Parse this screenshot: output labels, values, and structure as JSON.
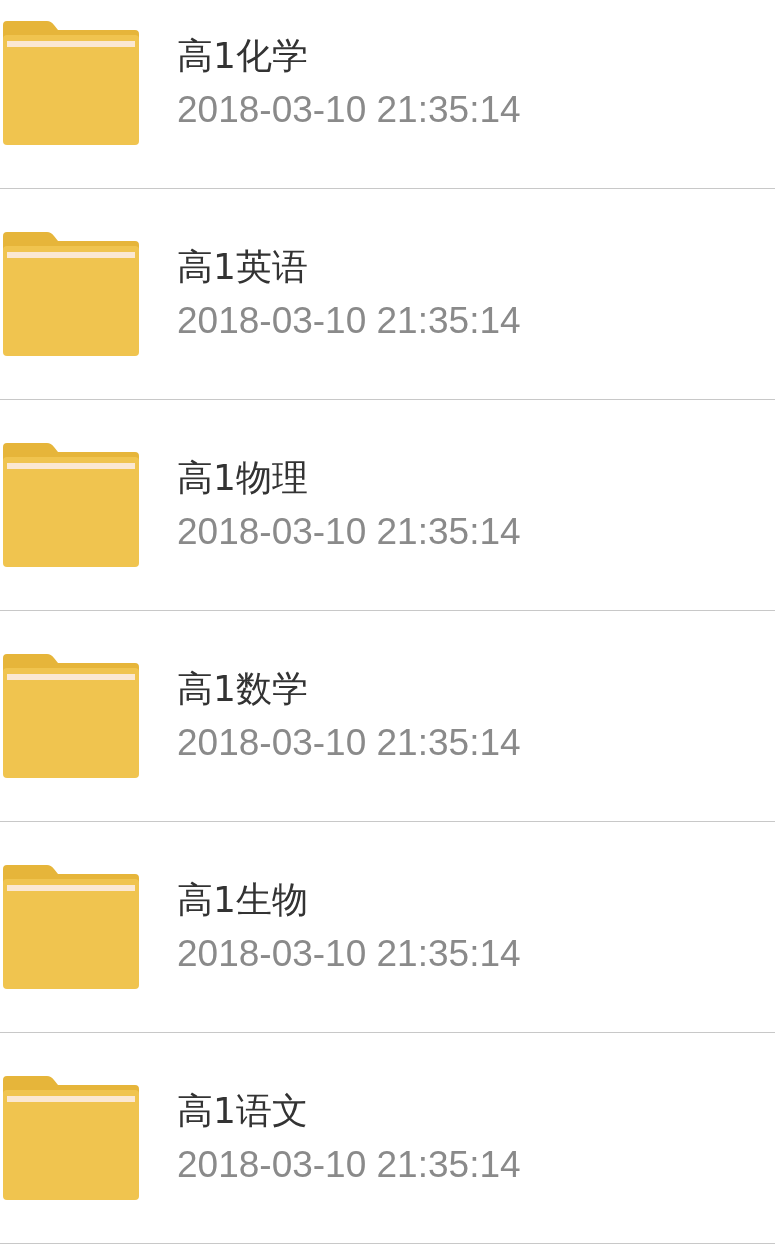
{
  "folders": [
    {
      "name": "高1化学",
      "modified": "2018-03-10 21:35:14"
    },
    {
      "name": "高1英语",
      "modified": "2018-03-10 21:35:14"
    },
    {
      "name": "高1物理",
      "modified": "2018-03-10 21:35:14"
    },
    {
      "name": "高1数学",
      "modified": "2018-03-10 21:35:14"
    },
    {
      "name": "高1生物",
      "modified": "2018-03-10 21:35:14"
    },
    {
      "name": "高1语文",
      "modified": "2018-03-10 21:35:14"
    }
  ]
}
